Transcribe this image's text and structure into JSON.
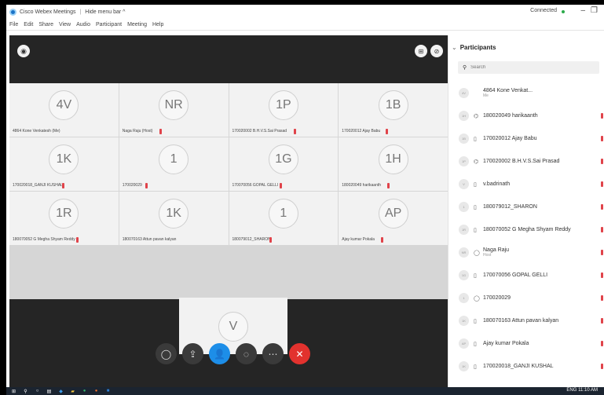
{
  "window": {
    "title": "Cisco Webex Meetings",
    "hide_menu": "Hide menu bar ^",
    "status": "Connected",
    "colors": {
      "status_dot": "#2cab4b",
      "accent": "#1d8ee8",
      "end": "#e2322e"
    }
  },
  "menu": [
    "File",
    "Edit",
    "Share",
    "View",
    "Audio",
    "Participant",
    "Meeting",
    "Help"
  ],
  "tiles": [
    {
      "initials": "4V",
      "label": "4864 Kone Venkatesh (Me)",
      "muted": false
    },
    {
      "initials": "NR",
      "label": "Naga Raju (Host)",
      "muted": true
    },
    {
      "initials": "1P",
      "label": "170020002 B.H.V.S.Sai Prasad",
      "muted": true
    },
    {
      "initials": "1B",
      "label": "170020012 Ajay Babu",
      "muted": true
    },
    {
      "initials": "1K",
      "label": "170020018_GANJI KUSHAL",
      "muted": true
    },
    {
      "initials": "1",
      "label": "170020029",
      "muted": true
    },
    {
      "initials": "1G",
      "label": "170070056 GOPAL GELLI",
      "muted": true
    },
    {
      "initials": "1H",
      "label": "180020049 harikaanth",
      "muted": true
    },
    {
      "initials": "1R",
      "label": "180070052 G Megha Shyam Reddy",
      "muted": true
    },
    {
      "initials": "1K",
      "label": "180070163 Attun pavan kalyan",
      "muted": false
    },
    {
      "initials": "1",
      "label": "180079012_SHARON",
      "muted": true
    },
    {
      "initials": "AP",
      "label": "Ajay kumar Pokala",
      "muted": true
    }
  ],
  "bottom_tile": {
    "initials": "V"
  },
  "controls": [
    {
      "name": "mute-button",
      "icon": "mic-icon",
      "glyph": "◯"
    },
    {
      "name": "share-button",
      "icon": "share-icon",
      "glyph": "⇪"
    },
    {
      "name": "participants-button",
      "icon": "person-icon",
      "glyph": "👤"
    },
    {
      "name": "chat-button",
      "icon": "chat-icon",
      "glyph": "◌"
    },
    {
      "name": "more-button",
      "icon": "more-icon",
      "glyph": "⋯"
    },
    {
      "name": "end-meeting-button",
      "icon": "close-icon",
      "glyph": "✕"
    }
  ],
  "panel": {
    "title": "Participants",
    "search_placeholder": "Search",
    "participants": [
      {
        "initials": "4V",
        "device": "",
        "name": "4864 Kone Venkat...",
        "sub": "Me",
        "mic": false
      },
      {
        "initials": "1H",
        "device": "⌬",
        "name": "180020049 harikaanth",
        "sub": "",
        "mic": true
      },
      {
        "initials": "1B",
        "device": "▯",
        "name": "170020012 Ajay Babu",
        "sub": "",
        "mic": true
      },
      {
        "initials": "1P",
        "device": "⌬",
        "name": "170020002 B.H.V.S.Sai Prasad",
        "sub": "",
        "mic": true
      },
      {
        "initials": "V",
        "device": "▯",
        "name": "v.badrinath",
        "sub": "",
        "mic": true
      },
      {
        "initials": "1",
        "device": "▯",
        "name": "180079012_SHARON",
        "sub": "",
        "mic": true
      },
      {
        "initials": "1R",
        "device": "▯",
        "name": "180070052 G Megha Shyam Reddy",
        "sub": "",
        "mic": true
      },
      {
        "initials": "NR",
        "device": "◯",
        "name": "Naga Raju",
        "sub": "Host",
        "mic": true
      },
      {
        "initials": "1G",
        "device": "▯",
        "name": "170070056 GOPAL GELLI",
        "sub": "",
        "mic": true
      },
      {
        "initials": "1",
        "device": "◯",
        "name": "170020029",
        "sub": "",
        "mic": true
      },
      {
        "initials": "1K",
        "device": "▯",
        "name": "180070163 Attun pavan kalyan",
        "sub": "",
        "mic": true
      },
      {
        "initials": "AP",
        "device": "▯",
        "name": "Ajay kumar Pokala",
        "sub": "",
        "mic": true
      },
      {
        "initials": "1K",
        "device": "▯",
        "name": "170020018_GANJI KUSHAL",
        "sub": "",
        "mic": true
      }
    ]
  },
  "taskbar": {
    "tray": "ENG  11:10 AM"
  }
}
